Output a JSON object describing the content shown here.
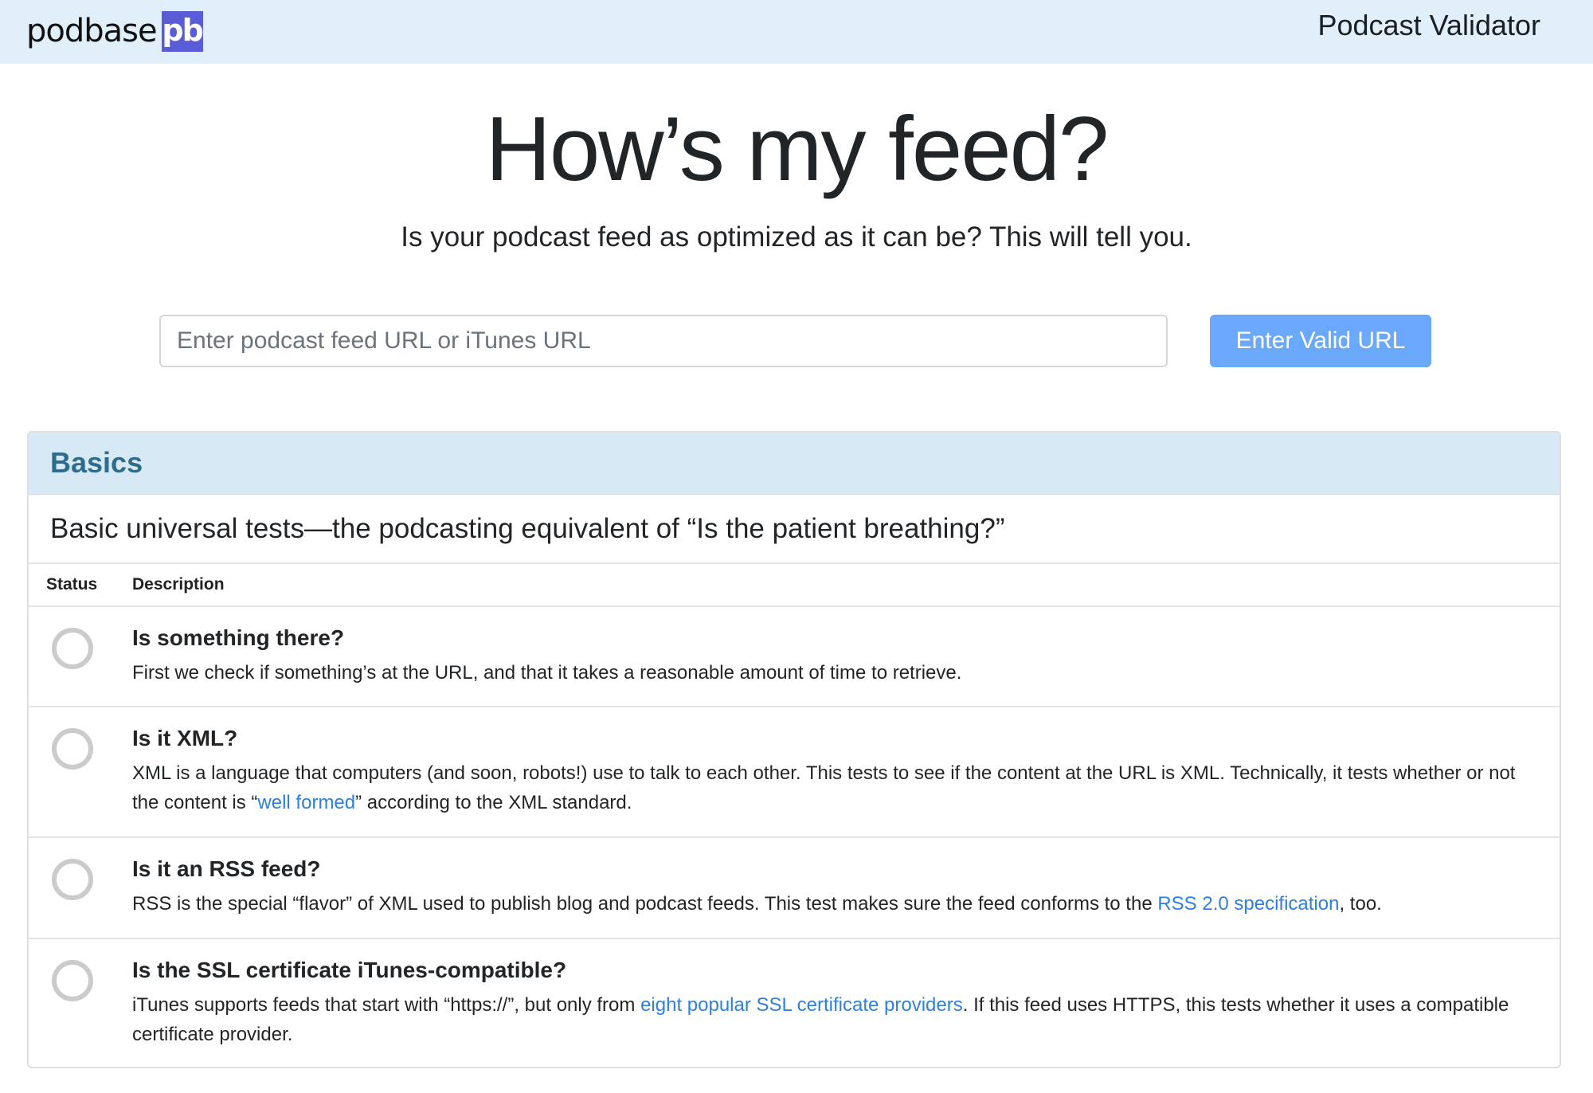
{
  "header": {
    "brand_word": "podbase",
    "brand_mark": "pb",
    "brand_color": "#5a5bd6",
    "app_title": "Podcast Validator"
  },
  "hero": {
    "title": "How’s my feed?",
    "subtitle": "Is your podcast feed as optimized as it can be? This will tell you."
  },
  "search": {
    "placeholder": "Enter podcast feed URL or iTunes URL",
    "value": "",
    "button_label": "Enter Valid URL",
    "button_color": "#6aa8fb"
  },
  "section": {
    "title": "Basics",
    "subtitle": "Basic universal tests—the podcasting equivalent of “Is the patient breathing?”",
    "columns": [
      "Status",
      "Description"
    ],
    "tests": [
      {
        "status": "pending",
        "title": "Is something there?",
        "desc_before": "First we check if something’s at the URL, and that it takes a reasonable amount of time to retrieve.",
        "link": "",
        "desc_after": ""
      },
      {
        "status": "pending",
        "title": "Is it XML?",
        "desc_before": "XML is a language that computers (and soon, robots!) use to talk to each other. This tests to see if the content at the URL is XML. Technically, it tests whether or not the content is “",
        "link": "well formed",
        "desc_after": "” according to the XML standard."
      },
      {
        "status": "pending",
        "title": "Is it an RSS feed?",
        "desc_before": "RSS is the special “flavor” of XML used to publish blog and podcast feeds. This test makes sure the feed conforms to the ",
        "link": "RSS 2.0 specification",
        "desc_after": ", too."
      },
      {
        "status": "pending",
        "title": "Is the SSL certificate iTunes-compatible?",
        "desc_before": "iTunes supports feeds that start with “https://”, but only from ",
        "link": "eight popular SSL certificate providers",
        "desc_after": ". If this feed uses HTTPS, this tests whether it uses a compatible certificate provider."
      }
    ]
  }
}
